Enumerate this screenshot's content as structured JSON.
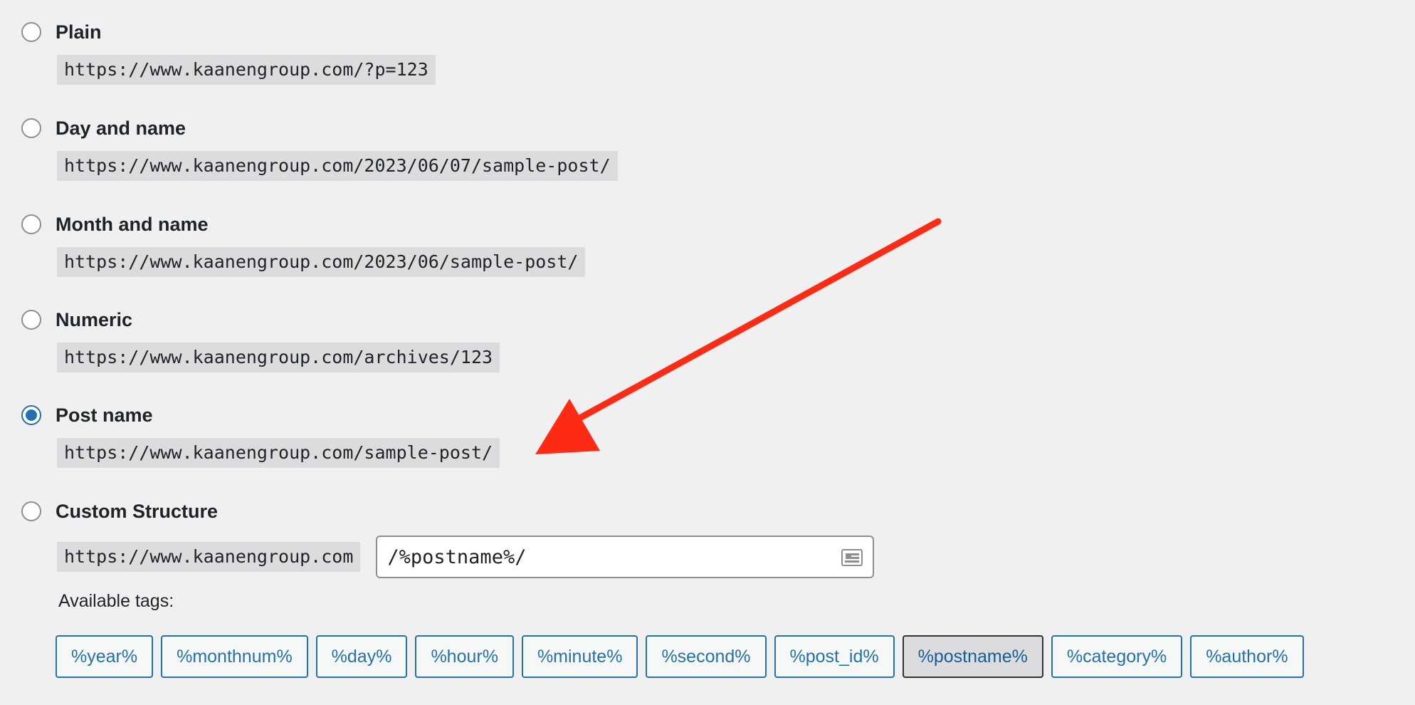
{
  "options": [
    {
      "label": "Plain",
      "example": "https://www.kaanengroup.com/?p=123",
      "checked": false
    },
    {
      "label": "Day and name",
      "example": "https://www.kaanengroup.com/2023/06/07/sample-post/",
      "checked": false
    },
    {
      "label": "Month and name",
      "example": "https://www.kaanengroup.com/2023/06/sample-post/",
      "checked": false
    },
    {
      "label": "Numeric",
      "example": "https://www.kaanengroup.com/archives/123",
      "checked": false
    },
    {
      "label": "Post name",
      "example": "https://www.kaanengroup.com/sample-post/",
      "checked": true
    },
    {
      "label": "Custom Structure",
      "checked": false
    }
  ],
  "custom": {
    "base_url": "https://www.kaanengroup.com",
    "structure_value": "/%postname%/",
    "input_icon": "id-card-icon"
  },
  "available_tags_label": "Available tags:",
  "tags": [
    "%year%",
    "%monthnum%",
    "%day%",
    "%hour%",
    "%minute%",
    "%second%",
    "%post_id%",
    "%postname%",
    "%category%",
    "%author%"
  ],
  "active_tag": "%postname%",
  "colors": {
    "accent": "#2271b1",
    "annotation_arrow": "#ff2a14"
  }
}
